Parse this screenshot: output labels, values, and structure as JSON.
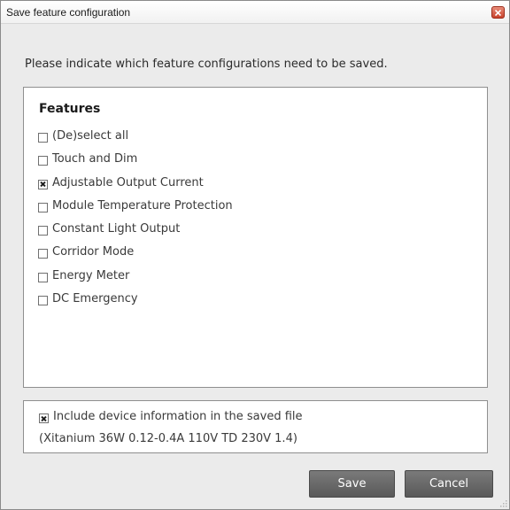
{
  "window": {
    "title": "Save feature configuration",
    "close_icon": "close-icon",
    "accent_close": "#c7432d"
  },
  "prompt": "Please indicate which feature configurations need to be saved.",
  "features": {
    "heading": "Features",
    "items": [
      {
        "label": "(De)select all",
        "checked": false
      },
      {
        "label": "Touch and Dim",
        "checked": false
      },
      {
        "label": "Adjustable Output Current",
        "checked": true
      },
      {
        "label": "Module Temperature Protection",
        "checked": false
      },
      {
        "label": "Constant Light Output",
        "checked": false
      },
      {
        "label": "Corridor Mode",
        "checked": false
      },
      {
        "label": "Energy Meter",
        "checked": false
      },
      {
        "label": "DC Emergency",
        "checked": false
      }
    ]
  },
  "device": {
    "include_label": "Include device information in the saved file",
    "include_checked": true,
    "info": "(Xitanium 36W 0.12-0.4A 110V TD 230V 1.4)"
  },
  "buttons": {
    "save": "Save",
    "cancel": "Cancel"
  }
}
